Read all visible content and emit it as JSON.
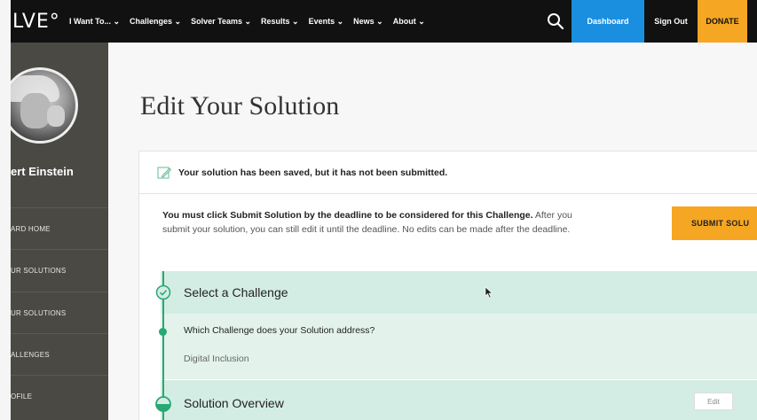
{
  "nav": {
    "logo": "LVE°",
    "items": [
      "I Want To... ⌄",
      "Challenges ⌄",
      "Solver Teams ⌄",
      "Results ⌄",
      "Events ⌄",
      "News ⌄",
      "About ⌄"
    ],
    "search_icon": "search-icon",
    "dashboard_label": "Dashboard",
    "signout_label": "Sign Out",
    "donate_label": "DONATE"
  },
  "sidebar": {
    "username": "ert Einstein",
    "items": [
      "ARD HOME",
      "UR SOLUTIONS",
      "UR SOLUTIONS",
      "ALLENGES",
      "OFILE"
    ]
  },
  "main": {
    "title": "Edit Your Solution",
    "notice": "Your solution has been saved, but it has not been submitted.",
    "deadline_bold": "You must click Submit Solution by the deadline to be considered for this Challenge.",
    "deadline_rest": " After you submit your solution, you can still edit it until the deadline. No edits can be made after the deadline.",
    "submit_label": "SUBMIT SOLU",
    "sections": [
      {
        "title": "Select a Challenge",
        "question": "Which Challenge does your Solution address?",
        "answer": "Digital Inclusion"
      },
      {
        "title": "Solution Overview",
        "edit_label": "Edit"
      }
    ]
  },
  "colors": {
    "nav_bg": "#111111",
    "dashboard": "#1a8fe0",
    "donate": "#f5a623",
    "sidebar_bg": "#4b4944",
    "accent_green": "#27a874",
    "section_bg": "#d4ede4"
  }
}
